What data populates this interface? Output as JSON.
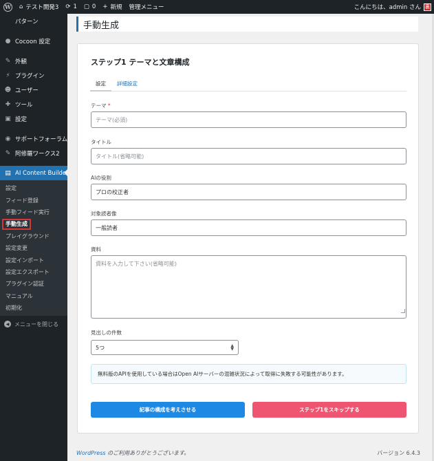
{
  "adminbar": {
    "site_name": "テスト開発3",
    "updates_count": "1",
    "comments_count": "0",
    "new_label": "新規",
    "admin_menu_label": "管理メニュー",
    "greeting": "こんにちは、admin さん",
    "avatar_text": "裏"
  },
  "sidebar": {
    "items_top": [
      {
        "label": "パターン",
        "icon": "pattern-icon"
      }
    ],
    "cocoon": {
      "label": "Cocoon 設定",
      "icon": "cocoon-icon"
    },
    "items_mid": [
      {
        "label": "外観",
        "icon": "appearance-icon"
      },
      {
        "label": "プラグイン",
        "icon": "plugins-icon"
      },
      {
        "label": "ユーザー",
        "icon": "users-icon"
      },
      {
        "label": "ツール",
        "icon": "tools-icon"
      },
      {
        "label": "設定",
        "icon": "settings-icon"
      }
    ],
    "items_low": [
      {
        "label": "サポートフォーラム2",
        "icon": "support-icon"
      },
      {
        "label": "阿修羅ワークス2",
        "icon": "works-icon"
      }
    ],
    "current": {
      "label": "AI Content Builder",
      "icon": "ai-builder-icon"
    },
    "submenu": [
      "設定",
      "フィード登録",
      "手動フィード実行",
      "手動生成",
      "プレイグラウンド",
      "設定変更",
      "設定インポート",
      "設定エクスポート",
      "プラグイン認証",
      "マニュアル",
      "初期化"
    ],
    "active_submenu": "手動生成",
    "collapse_label": "メニューを閉じる"
  },
  "page": {
    "title": "手動生成"
  },
  "card": {
    "title": "ステップ1 テーマと文章構成",
    "tabs": [
      "設定",
      "詳細設定"
    ],
    "fields": {
      "theme": {
        "label": "テーマ",
        "required_mark": "*",
        "placeholder": "テーマ(必須)"
      },
      "title": {
        "label": "タイトル",
        "placeholder": "タイトル(省略可能)"
      },
      "role": {
        "label": "AIの役割",
        "value": "プロの校正者"
      },
      "audience": {
        "label": "対象読者像",
        "value": "一般読者"
      },
      "material": {
        "label": "資料",
        "placeholder": "資料を入力して下さい(省略可能)"
      },
      "headings": {
        "label": "見出しの件数",
        "value": "5つ"
      }
    },
    "notice": "無料版のAPIを使用している場合はOpen AIサーバーの混雑状況によって取得に失敗する可能性があります。",
    "buttons": {
      "generate": "記事の構成を考えさせる",
      "skip": "ステップ1をスキップする"
    }
  },
  "footer": {
    "wp_link": "WordPress",
    "thanks": " のご利用ありがとうございます。",
    "version": "バージョン 6.4.3"
  },
  "colors": {
    "accent": "#2271b1",
    "primary_button": "#1e88e5",
    "secondary_button": "#ef5470",
    "admin_dark": "#1d2327"
  }
}
